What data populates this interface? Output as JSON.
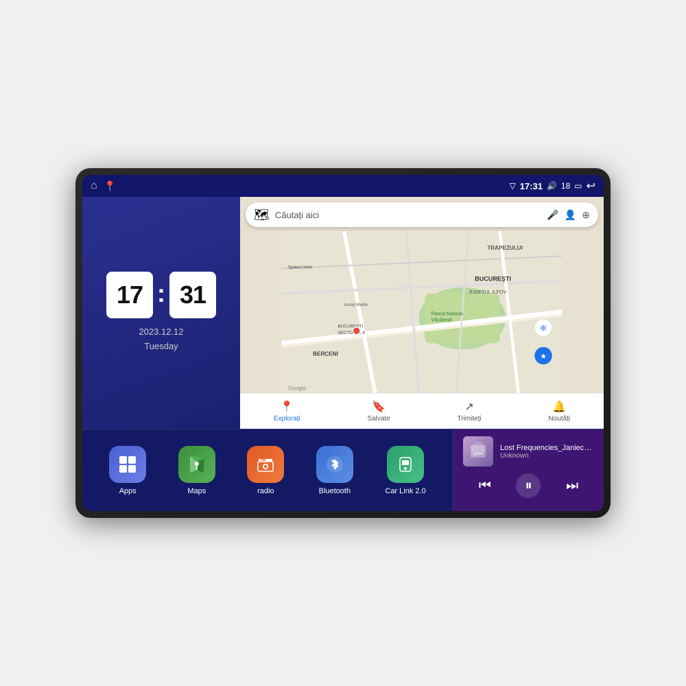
{
  "device": {
    "screen_bg": "#1a1e6e"
  },
  "status_bar": {
    "left_icons": [
      "home",
      "location"
    ],
    "time": "17:31",
    "volume_level": "18",
    "battery_icon": "battery",
    "back_icon": "back",
    "signal_icon": "signal"
  },
  "clock": {
    "hours": "17",
    "minutes": "31",
    "date": "2023.12.12",
    "day": "Tuesday"
  },
  "map": {
    "search_placeholder": "Căutați aici",
    "nav_items": [
      {
        "label": "Explorați",
        "active": true
      },
      {
        "label": "Salvate",
        "active": false
      },
      {
        "label": "Trimiteți",
        "active": false
      },
      {
        "label": "Noutăți",
        "active": false
      }
    ],
    "labels": [
      "TRAPEZULUI",
      "BUCUREȘTI",
      "JUDEȚUL ILFOV",
      "BERCENI",
      "Parcul Natural Văcărești",
      "Leroy Merlin",
      "BUCUREȘTI SECTORUL 4"
    ]
  },
  "apps": [
    {
      "id": "apps",
      "label": "Apps",
      "color_class": "app-apps",
      "icon": "⊞"
    },
    {
      "id": "maps",
      "label": "Maps",
      "color_class": "app-maps",
      "icon": "📍"
    },
    {
      "id": "radio",
      "label": "radio",
      "color_class": "app-radio",
      "icon": "📻"
    },
    {
      "id": "bluetooth",
      "label": "Bluetooth",
      "color_class": "app-bluetooth",
      "icon": "⬡"
    },
    {
      "id": "carlink",
      "label": "Car Link 2.0",
      "color_class": "app-carlink",
      "icon": "📱"
    }
  ],
  "music": {
    "title": "Lost Frequencies_Janieck Devy-...",
    "artist": "Unknown",
    "controls": {
      "prev": "⏮",
      "play": "⏸",
      "next": "⏭"
    }
  }
}
